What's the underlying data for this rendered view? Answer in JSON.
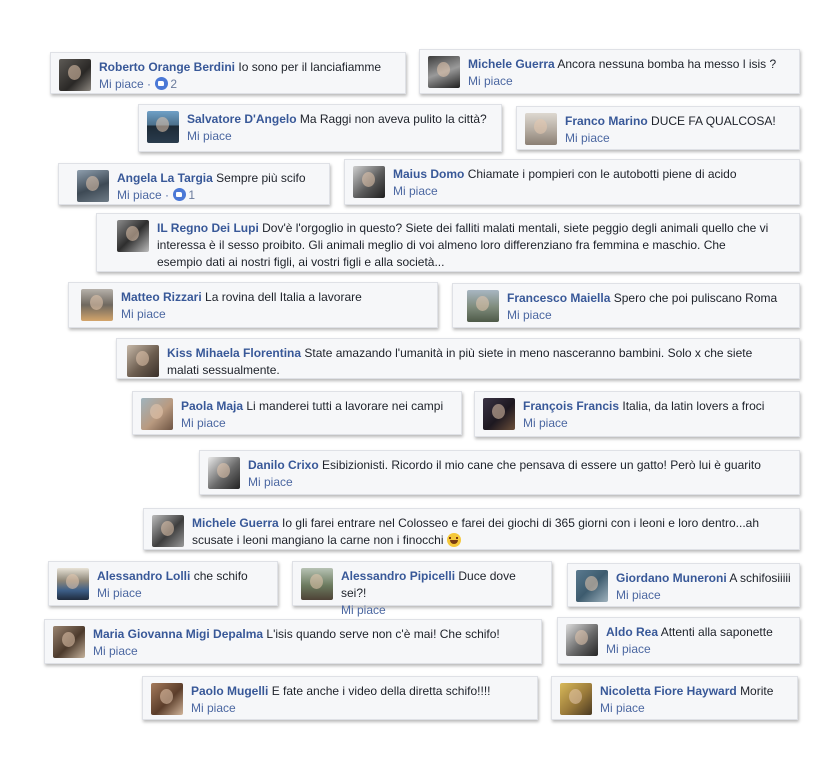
{
  "like_label": "Mi piace",
  "colors": {
    "author": "#385898",
    "meta": "#4b67a1",
    "card_bg": "#f6f7f9",
    "reaction": "#4a78d6"
  },
  "comments": [
    {
      "author": "Roberto Orange Berdini",
      "text": "Io sono per il lanciafiamme",
      "reactions": "2",
      "avatar_icon": "profile-photo-icon"
    },
    {
      "author": "Michele Guerra",
      "text": "Ancora nessuna bomba ha messo l isis ?",
      "avatar_icon": "profile-photo-icon"
    },
    {
      "author": "Salvatore D'Angelo",
      "text": "Ma Raggi non aveva pulito la città?",
      "avatar_icon": "profile-photo-icon"
    },
    {
      "author": "Franco Marino",
      "text": "DUCE FA QUALCOSA!",
      "avatar_icon": "profile-photo-icon"
    },
    {
      "author": "Angela La Targia",
      "text": "Sempre più scifo",
      "reactions": "1",
      "avatar_icon": "profile-photo-icon"
    },
    {
      "author": "Maius Domo",
      "text": "Chiamate i pompieri con le autobotti piene di acido",
      "avatar_icon": "profile-photo-icon"
    },
    {
      "author": "IL Regno Dei Lupi",
      "text": "Dov'è l'orgoglio in questo? Siete dei falliti malati mentali, siete peggio degli animali quello che vi interessa è il sesso proibito. Gli animali meglio di voi almeno loro differenziano fra femmina e maschio. Che esempio dati ai nostri figli, ai vostri figli e alla società...",
      "avatar_icon": "profile-photo-icon"
    },
    {
      "author": "Matteo Rizzari",
      "text": "La rovina dell Italia a lavorare",
      "avatar_icon": "profile-photo-icon"
    },
    {
      "author": "Francesco Maiella",
      "text": "Spero che poi puliscano Roma",
      "avatar_icon": "profile-photo-icon"
    },
    {
      "author": "Kiss Mihaela Florentina",
      "text": "State amazando l'umanità in più siete in meno nasceranno bambini. Solo x che siete malati sessualmente.",
      "avatar_icon": "profile-photo-icon"
    },
    {
      "author": "Paola Maja",
      "text": "Li manderei tutti a lavorare nei campi",
      "avatar_icon": "profile-photo-icon"
    },
    {
      "author": "François Francis",
      "text": "Italia, da latin lovers a froci",
      "avatar_icon": "profile-photo-icon"
    },
    {
      "author": "Danilo Crixo",
      "text": "Esibizionisti. Ricordo il mio cane che pensava di essere un gatto! Però lui è guarito",
      "avatar_icon": "profile-photo-icon"
    },
    {
      "author": "Michele Guerra",
      "text": "Io gli farei entrare nel Colosseo e farei dei giochi di 365 giorni con i leoni e loro dentro...ah scusate i leoni mangiano la carne non i finocchi",
      "emoji": "laughing-emoji-icon",
      "avatar_icon": "profile-photo-icon"
    },
    {
      "author": "Alessandro Lolli",
      "text": "che schifo",
      "avatar_icon": "profile-photo-icon"
    },
    {
      "author": "Alessandro Pipicelli",
      "text": "Duce dove sei?!",
      "avatar_icon": "profile-photo-icon"
    },
    {
      "author": "Giordano Muneroni",
      "text": "A schifosiiiii",
      "avatar_icon": "profile-photo-icon"
    },
    {
      "author": "Maria Giovanna Migi Depalma",
      "text": "L'isis quando serve non c'è mai! Che schifo!",
      "avatar_icon": "profile-photo-icon"
    },
    {
      "author": "Aldo Rea",
      "text": "Attenti alla saponette",
      "avatar_icon": "profile-photo-icon"
    },
    {
      "author": "Paolo Mugelli",
      "text": "E fate anche i video della diretta schifo!!!!",
      "avatar_icon": "profile-photo-icon"
    },
    {
      "author": "Nicoletta Fiore Hayward",
      "text": "Morite",
      "avatar_icon": "profile-photo-icon"
    }
  ]
}
